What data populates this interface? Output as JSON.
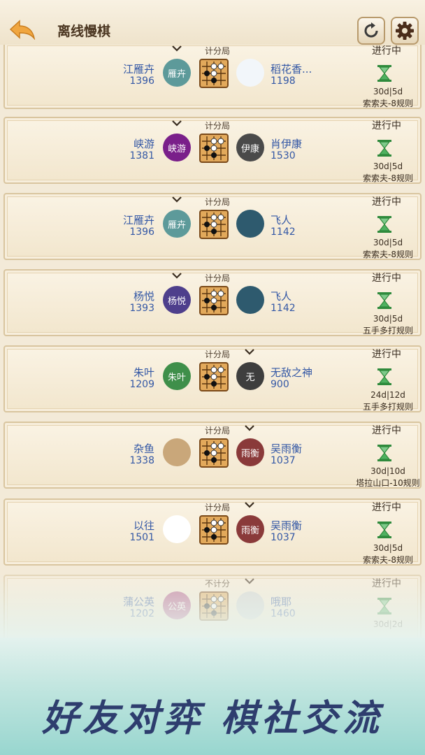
{
  "header": {
    "title": "离线慢棋",
    "back_icon": "back-arrow-icon",
    "refresh_icon": "refresh-icon",
    "settings_icon": "gear-icon",
    "accent_color": "#f0a640"
  },
  "games": [
    {
      "scoring": "计分局",
      "chevron_side": "left",
      "status": "进行中",
      "left": {
        "name": "江雁卉",
        "rating": "1396",
        "avatar_text": "雁卉",
        "avatar_color": "#5d9a9a"
      },
      "right": {
        "name": "稻花香...",
        "rating": "1198",
        "avatar_text": "",
        "avatar_color": "#f2f6fa"
      },
      "time": "30d|5d",
      "rule": "索索夫-8规则"
    },
    {
      "scoring": "计分局",
      "chevron_side": "left",
      "status": "进行中",
      "left": {
        "name": "峡游",
        "rating": "1381",
        "avatar_text": "峡游",
        "avatar_color": "#7a1f8a"
      },
      "right": {
        "name": "肖伊康",
        "rating": "1530",
        "avatar_text": "伊康",
        "avatar_color": "#4a4a4a"
      },
      "time": "30d|5d",
      "rule": "索索夫-8规则"
    },
    {
      "scoring": "计分局",
      "chevron_side": "left",
      "status": "进行中",
      "left": {
        "name": "江雁卉",
        "rating": "1396",
        "avatar_text": "雁卉",
        "avatar_color": "#5d9a9a"
      },
      "right": {
        "name": "飞人",
        "rating": "1142",
        "avatar_text": "",
        "avatar_color": "#2e5a6e"
      },
      "time": "30d|5d",
      "rule": "索索夫-8规则"
    },
    {
      "scoring": "计分局",
      "chevron_side": "left",
      "status": "进行中",
      "left": {
        "name": "杨悦",
        "rating": "1393",
        "avatar_text": "杨悦",
        "avatar_color": "#4e3f8c"
      },
      "right": {
        "name": "飞人",
        "rating": "1142",
        "avatar_text": "",
        "avatar_color": "#2e5a6e"
      },
      "time": "30d|5d",
      "rule": "五手多打规则"
    },
    {
      "scoring": "计分局",
      "chevron_side": "right",
      "status": "进行中",
      "left": {
        "name": "朱叶",
        "rating": "1209",
        "avatar_text": "朱叶",
        "avatar_color": "#3f8f4a"
      },
      "right": {
        "name": "无敌之神",
        "rating": "900",
        "avatar_text": "无",
        "avatar_color": "#3e3e3e"
      },
      "time": "24d|12d",
      "rule": "五手多打规则"
    },
    {
      "scoring": "计分局",
      "chevron_side": "right",
      "status": "进行中",
      "left": {
        "name": "杂鱼",
        "rating": "1338",
        "avatar_text": "",
        "avatar_color": "#c9a77a"
      },
      "right": {
        "name": "吴雨衡",
        "rating": "1037",
        "avatar_text": "雨衡",
        "avatar_color": "#8a3a3a"
      },
      "time": "30d|10d",
      "rule": "塔拉山口-10规则"
    },
    {
      "scoring": "计分局",
      "chevron_side": "right",
      "status": "进行中",
      "left": {
        "name": "以往",
        "rating": "1501",
        "avatar_text": "",
        "avatar_color": "#ffffff"
      },
      "right": {
        "name": "吴雨衡",
        "rating": "1037",
        "avatar_text": "雨衡",
        "avatar_color": "#8a3a3a"
      },
      "time": "30d|5d",
      "rule": "索索夫-8规则"
    },
    {
      "scoring": "不计分",
      "chevron_side": "right",
      "status": "进行中",
      "left": {
        "name": "蒲公英",
        "rating": "1202",
        "avatar_text": "公英",
        "avatar_color": "#b0558a"
      },
      "right": {
        "name": "哦耶",
        "rating": "1460",
        "avatar_text": "",
        "avatar_color": "#cfd6d8"
      },
      "time": "30d|2d",
      "rule": ""
    }
  ],
  "banner": {
    "slogan": "好友对弈 棋社交流"
  }
}
